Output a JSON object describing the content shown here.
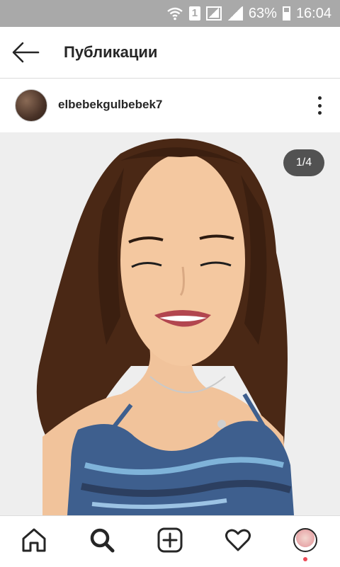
{
  "status_bar": {
    "battery": "63%",
    "time": "16:04",
    "sim_label": "1",
    "icons": [
      "wifi-icon",
      "sim-icon",
      "signal-icon",
      "signal-icon",
      "battery-icon"
    ]
  },
  "header": {
    "title": "Публикации",
    "back_icon": "arrow-left-icon"
  },
  "post": {
    "username": "elbebekgulbebek7",
    "avatar": "avatar",
    "more_icon": "more-vertical-icon",
    "image_counter": "1/4",
    "image_description_icon": "photo"
  },
  "bottom_nav": {
    "items": [
      "home-icon",
      "search-icon",
      "new-post-icon",
      "heart-icon",
      "profile-avatar"
    ],
    "active": "search-icon"
  },
  "colors": {
    "status_bar": "#a9a9a9",
    "text": "#262626",
    "notification_dot": "#ed4956"
  }
}
